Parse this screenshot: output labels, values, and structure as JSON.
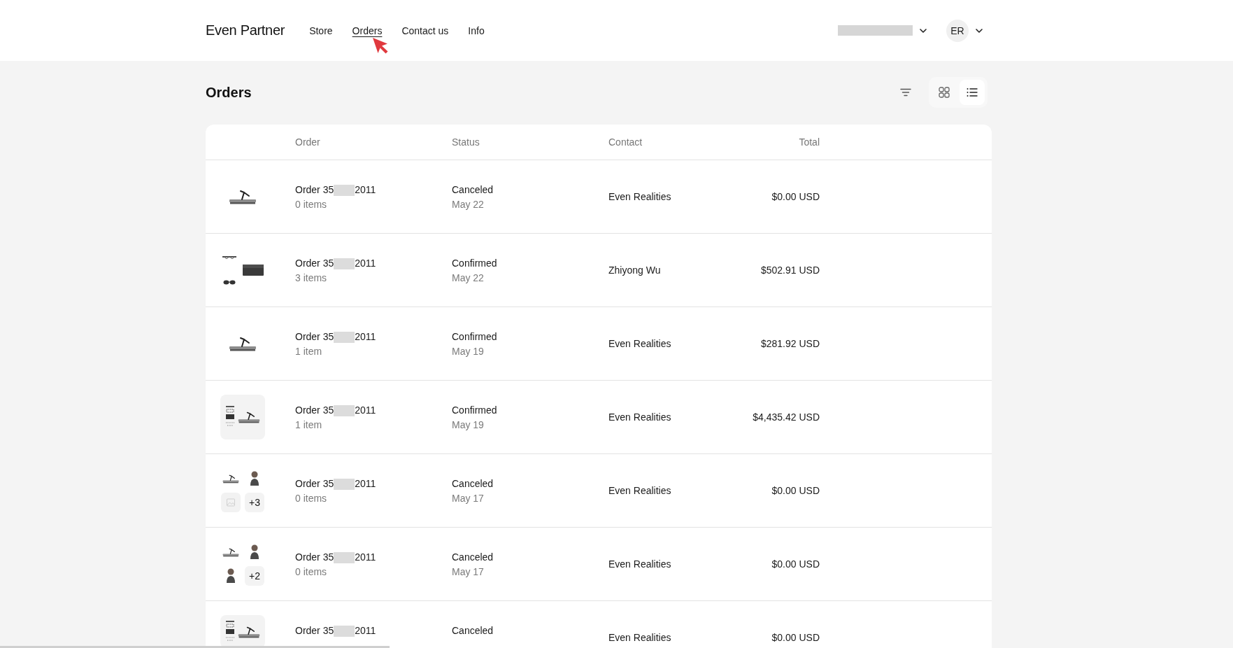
{
  "header": {
    "brand": "Even Partner",
    "nav": [
      {
        "label": "Store",
        "selected": false
      },
      {
        "label": "Orders",
        "selected": true
      },
      {
        "label": "Contact us",
        "selected": false
      },
      {
        "label": "Info",
        "selected": false
      }
    ],
    "account": {
      "name_redacted": true
    },
    "user": {
      "initials": "ER"
    }
  },
  "page": {
    "title": "Orders",
    "view_modes": [
      {
        "kind": "grid",
        "selected": false
      },
      {
        "kind": "list",
        "selected": true
      }
    ]
  },
  "table": {
    "columns": [
      "Order",
      "Status",
      "Contact",
      "Total"
    ],
    "rows": [
      {
        "thumbnail": {
          "kind": "single",
          "images": [
            {
              "kind": "stand"
            }
          ]
        },
        "order": {
          "prefix": "Order 35",
          "redacted": true,
          "suffix": "2011"
        },
        "items": "0 items",
        "status": "Canceled",
        "date": "May 22",
        "contact": "Even Realities",
        "total": "$0.00 USD"
      },
      {
        "thumbnail": {
          "kind": "cluster",
          "images": [
            {
              "kind": "glasses"
            },
            {
              "kind": "case"
            },
            {
              "kind": "sunglasses"
            }
          ]
        },
        "order": {
          "prefix": "Order 35",
          "redacted": true,
          "suffix": "2011"
        },
        "items": "3 items",
        "status": "Confirmed",
        "date": "May 22",
        "contact": "Zhiyong Wu",
        "total": "$502.91 USD"
      },
      {
        "thumbnail": {
          "kind": "single",
          "images": [
            {
              "kind": "stand"
            }
          ]
        },
        "order": {
          "prefix": "Order 35",
          "redacted": true,
          "suffix": "2011"
        },
        "items": "1 item",
        "status": "Confirmed",
        "date": "May 19",
        "contact": "Even Realities",
        "total": "$281.92 USD"
      },
      {
        "thumbnail": {
          "kind": "tile",
          "images": [
            {
              "kind": "package"
            },
            {
              "kind": "stand"
            }
          ]
        },
        "order": {
          "prefix": "Order 35",
          "redacted": true,
          "suffix": "2011"
        },
        "items": "1 item",
        "status": "Confirmed",
        "date": "May 19",
        "contact": "Even Realities",
        "total": "$4,435.42 USD"
      },
      {
        "thumbnail": {
          "kind": "grid",
          "images": [
            {
              "kind": "stand"
            },
            {
              "kind": "person"
            },
            {
              "kind": "placeholder"
            },
            {
              "kind": "more",
              "label": "+3"
            }
          ]
        },
        "order": {
          "prefix": "Order 35",
          "redacted": true,
          "suffix": "2011"
        },
        "items": "0 items",
        "status": "Canceled",
        "date": "May 17",
        "contact": "Even Realities",
        "total": "$0.00 USD"
      },
      {
        "thumbnail": {
          "kind": "grid",
          "images": [
            {
              "kind": "stand"
            },
            {
              "kind": "person"
            },
            {
              "kind": "person"
            },
            {
              "kind": "more",
              "label": "+2"
            }
          ]
        },
        "order": {
          "prefix": "Order 35",
          "redacted": true,
          "suffix": "2011"
        },
        "items": "0 items",
        "status": "Canceled",
        "date": "May 17",
        "contact": "Even Realities",
        "total": "$0.00 USD"
      },
      {
        "thumbnail": {
          "kind": "tile",
          "images": [
            {
              "kind": "package"
            },
            {
              "kind": "stand"
            }
          ]
        },
        "order": {
          "prefix": "Order 35",
          "redacted": true,
          "suffix": "2011"
        },
        "status": "Canceled",
        "contact": "Even Realities",
        "total": "$0.00 USD"
      }
    ]
  }
}
